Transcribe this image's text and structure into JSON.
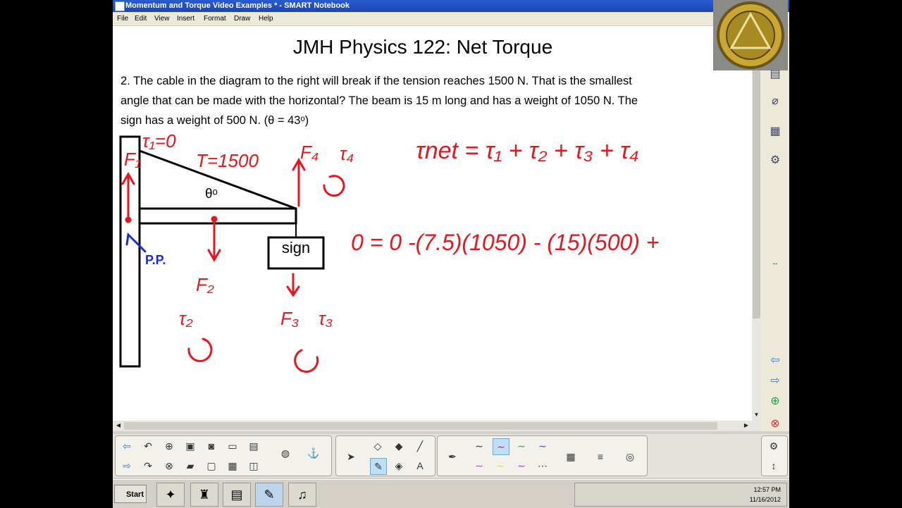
{
  "window": {
    "title": "Momentum and Torque Video Examples * - SMART Notebook"
  },
  "menu": [
    "File",
    "Edit",
    "View",
    "Insert",
    "Format",
    "Draw",
    "Help"
  ],
  "slide": {
    "title": "JMH Physics 122: Net Torque",
    "problem_line1": "2. The cable in the diagram to the right will break if the tension reaches 1500 N.  That is the smallest",
    "problem_line2": "angle that can be made with the horizontal?  The beam is 15 m long and has a weight of 1050 N.  The",
    "problem_line3": "sign has a weight of 500 N. (θ = 43ᵒ)",
    "sign_label": "sign",
    "theta_label": "θᵒ"
  },
  "handwriting": {
    "tau1": "τ₁=0",
    "tension": "T=1500",
    "f1": "F₁",
    "f4": "F₄",
    "tau4": "τ₄",
    "pp": "P.P.",
    "f2": "F₂",
    "tau2": "τ₂",
    "f3": "F₃",
    "tau3": "τ₃",
    "net_eq": "τnet = τ₁ + τ₂ + τ₃ + τ₄",
    "calc_eq": "0 = 0 -(7.5)(1050) - (15)(500) +"
  },
  "colors": {
    "ink_red": "#e8141e",
    "ink_blue": "#1a2bd8",
    "title_blue": "#1f4fc8"
  },
  "taskbar": {
    "start_label": "Start",
    "clock_time": "12:57 PM",
    "clock_date": "11/16/2012"
  }
}
